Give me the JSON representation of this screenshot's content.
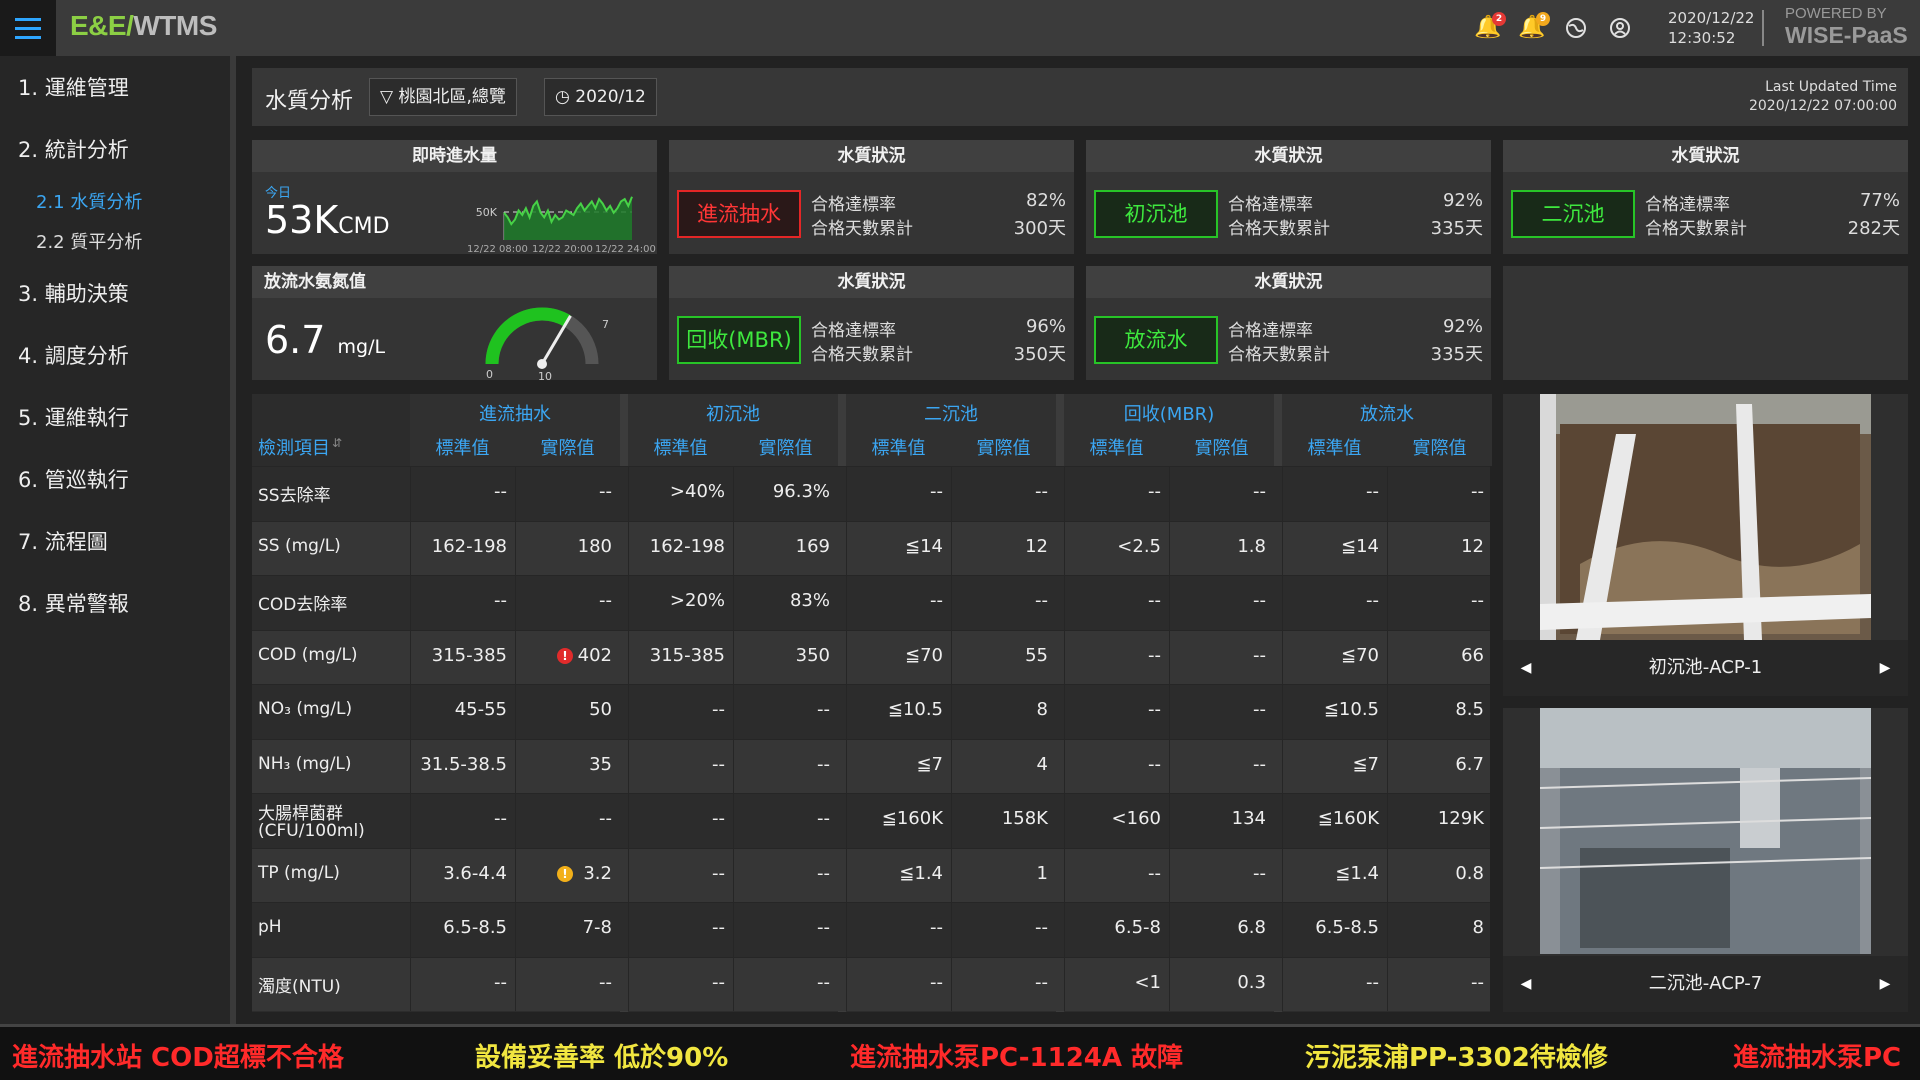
{
  "app": {
    "brand_a": "E&E/",
    "brand_b": "WTMS",
    "datetime_date": "2020/12/22",
    "datetime_time": "12:30:52",
    "powered_by_1": "POWERED BY",
    "powered_by_2": "WISE-PaaS",
    "notif_count_1": "2",
    "notif_count_2": "9"
  },
  "sidebar": {
    "items": [
      "1.  運維管理",
      "2. 統計分析",
      "3. 輔助決策",
      "4. 調度分析",
      "5. 運維執行",
      "6. 管巡執行",
      "7. 流程圖",
      "8. 異常警報"
    ],
    "subitems": [
      "2.1 水質分析",
      "2.2 質平分析"
    ]
  },
  "header": {
    "title": "水質分析",
    "filter": "桃園北區,總覽",
    "date": "2020/12",
    "last_updated_label": "Last Updated Time",
    "last_updated_value": "2020/12/22 07:00:00"
  },
  "inflow": {
    "title": "即時進水量",
    "today_label": "今日",
    "value": "53K",
    "unit": "CMD",
    "ref_label": "50K",
    "x_ticks": [
      "12/22 08:00",
      "12/22 20:00",
      "12/22 24:00"
    ],
    "series": [
      52,
      50,
      47,
      49,
      53,
      51,
      54,
      50,
      55,
      57,
      52,
      50,
      53,
      48,
      51,
      49,
      50,
      53,
      52,
      51,
      54,
      56,
      53,
      55,
      57,
      54,
      58,
      56,
      53,
      55,
      52,
      54,
      57,
      58,
      55,
      59
    ]
  },
  "ammonia": {
    "title": "放流水氨氮值",
    "value": "6.7",
    "unit": "mg/L",
    "gauge_min": "0",
    "gauge_max": "10",
    "gauge_mark": "7",
    "level": 0.67
  },
  "status_cards": [
    {
      "title": "水質狀況",
      "name": "進流抽水",
      "color": "red",
      "rate_label": "合格達標率",
      "rate": "82%",
      "days_label": "合格天數累計",
      "days": "300天"
    },
    {
      "title": "水質狀況",
      "name": "初沉池",
      "color": "green",
      "rate_label": "合格達標率",
      "rate": "92%",
      "days_label": "合格天數累計",
      "days": "335天"
    },
    {
      "title": "水質狀況",
      "name": "二沉池",
      "color": "green",
      "rate_label": "合格達標率",
      "rate": "77%",
      "days_label": "合格天數累計",
      "days": "282天"
    },
    {
      "title": "水質狀況",
      "name": "回收(MBR)",
      "color": "green",
      "rate_label": "合格達標率",
      "rate": "96%",
      "days_label": "合格天數累計",
      "days": "350天"
    },
    {
      "title": "水質狀況",
      "name": "放流水",
      "color": "green",
      "rate_label": "合格達標率",
      "rate": "92%",
      "days_label": "合格天數累計",
      "days": "335天"
    }
  ],
  "table": {
    "item_header": "檢測項目",
    "groups": [
      "進流抽水",
      "初沉池",
      "二沉池",
      "回收(MBR)",
      "放流水"
    ],
    "std_label": "標準值",
    "act_label": "實際值",
    "rows": [
      {
        "name": "SS去除率",
        "cells": [
          "--",
          "--",
          ">40%",
          "96.3%",
          "--",
          "--",
          "--",
          "--",
          "--",
          "--"
        ]
      },
      {
        "name": "SS (mg/L)",
        "cells": [
          "162-198",
          "180",
          "162-198",
          "169",
          "≦14",
          "12",
          "<2.5",
          "1.8",
          "≦14",
          "12"
        ]
      },
      {
        "name": "COD去除率",
        "cells": [
          "--",
          "--",
          ">20%",
          "83%",
          "--",
          "--",
          "--",
          "--",
          "--",
          "--"
        ]
      },
      {
        "name": "COD (mg/L)",
        "cells": [
          "315-385",
          "402",
          "315-385",
          "350",
          "≦70",
          "55",
          "--",
          "--",
          "≦70",
          "66"
        ],
        "alert": {
          "col": 1,
          "color": "#e12b2b"
        }
      },
      {
        "name": "NO₃ (mg/L)",
        "cells": [
          "45-55",
          "50",
          "--",
          "--",
          "≦10.5",
          "8",
          "--",
          "--",
          "≦10.5",
          "8.5"
        ]
      },
      {
        "name": "NH₃ (mg/L)",
        "cells": [
          "31.5-38.5",
          "35",
          "--",
          "--",
          "≦7",
          "4",
          "--",
          "--",
          "≦7",
          "6.7"
        ]
      },
      {
        "name": "大腸桿菌群",
        "name2": "(CFU/100ml)",
        "cells": [
          "--",
          "--",
          "--",
          "--",
          "≦160K",
          "158K",
          "<160",
          "134",
          "≦160K",
          "129K"
        ]
      },
      {
        "name": "TP (mg/L)",
        "cells": [
          "3.6-4.4",
          "3.2",
          "--",
          "--",
          "≦1.4",
          "1",
          "--",
          "--",
          "≦1.4",
          "0.8"
        ],
        "alert": {
          "col": 1,
          "color": "#f2b01a"
        }
      },
      {
        "name": "pH",
        "cells": [
          "6.5-8.5",
          "7-8",
          "--",
          "--",
          "--",
          "--",
          "6.5-8",
          "6.8",
          "6.5-8.5",
          "8"
        ]
      },
      {
        "name": "濁度(NTU)",
        "cells": [
          "--",
          "--",
          "--",
          "--",
          "--",
          "--",
          "<1",
          "0.3",
          "--",
          "--"
        ]
      }
    ]
  },
  "cameras": [
    {
      "label": "初沉池-ACP-1"
    },
    {
      "label": "二沉池-ACP-7"
    }
  ],
  "ticker": [
    {
      "text": "進流抽水站 COD超標不合格",
      "color": "#ff2a2a"
    },
    {
      "text": "設備妥善率 低於90%",
      "color": "#f1e640"
    },
    {
      "text": "進流抽水泵PC-1124A 故障",
      "color": "#ff2a2a"
    },
    {
      "text": "污泥泵浦PP-3302待檢修",
      "color": "#f1e640"
    },
    {
      "text": "進流抽水泵PC",
      "color": "#ff2a2a"
    }
  ]
}
